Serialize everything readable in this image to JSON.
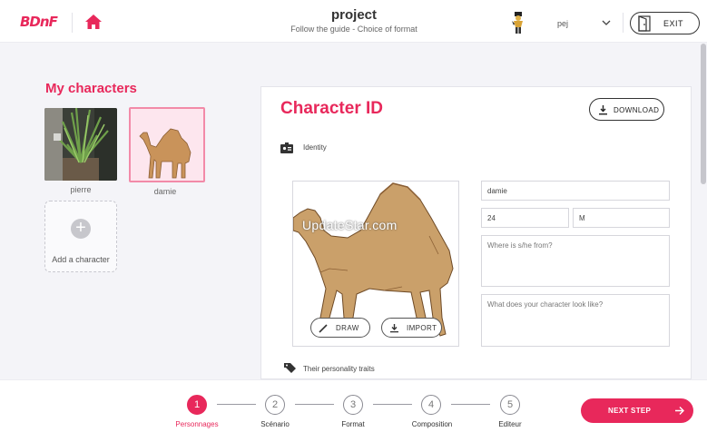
{
  "header": {
    "logo": "BDnF",
    "title": "project",
    "subtitle": "Follow the guide - Choice of format",
    "user_name": "pej",
    "exit_label": "EXIT"
  },
  "characters": {
    "heading": "My characters",
    "items": [
      {
        "name": "pierre"
      },
      {
        "name": "damie"
      }
    ],
    "add_label": "Add a character",
    "add_icon": "+"
  },
  "card": {
    "title": "Character ID",
    "download_label": "DOWNLOAD",
    "identity_label": "Identity",
    "personality_label": "Their personality traits",
    "image_watermark": "UpdateStar.com",
    "draw_label": "DRAW",
    "import_label": "IMPORT",
    "name_value": "damie",
    "age_value": "24",
    "gender_value": "M",
    "origin_placeholder": "Where is s/he from?",
    "looks_placeholder": "What does your character look like?"
  },
  "steps": [
    {
      "number": "1",
      "label": "Personnages"
    },
    {
      "number": "2",
      "label": "Scénario"
    },
    {
      "number": "3",
      "label": "Format"
    },
    {
      "number": "4",
      "label": "Composition"
    },
    {
      "number": "5",
      "label": "Editeur"
    }
  ],
  "next_label": "NEXT STEP",
  "colors": {
    "accent": "#e8285b"
  }
}
